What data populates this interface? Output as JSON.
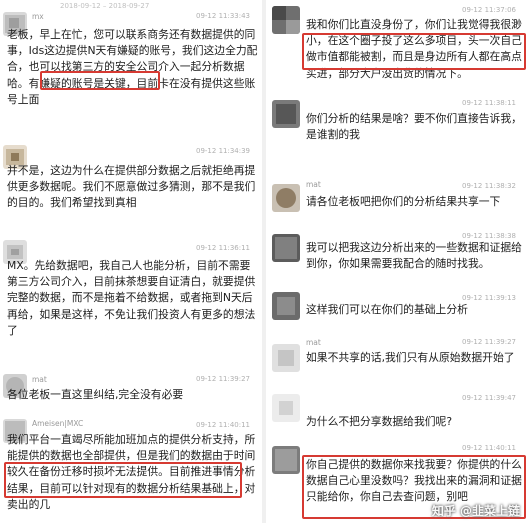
{
  "left": {
    "top_meta": "2018-09-12 – 2018-09-27",
    "messages": [
      {
        "name": "mx",
        "time": "09-12 11:33:43",
        "text": "老板，早上在忙，您可以联系商务还有数据提供的同事，Ids这边提供N天有嫌疑的账号，我们这边全力配合，也可以找第三方的安全公司介入一起分析数据哈。有嫌疑的账号是关键，目前卡在没有提供这些账号上面",
        "highlight": "我们这边全力配合,"
      },
      {
        "name": "",
        "time": "09-12 11:34:39",
        "text": "并不是，这边为什么在提供部分数据之后就拒绝再提供更多数据呢。我们不愿意做过多猜测，那不是我们的目的。我们希望找到真相"
      },
      {
        "name": "",
        "time": "09-12 11:36:11",
        "text": "MX。先给数据吧，我自己人也能分析，目前不需要第三方公司介入，目前抹茶想要自证清白，就要提供完整的数据，而不是拖着不给数据，或者拖到N天后再给，如果是这样，不免让我们投资人有更多的想法了"
      },
      {
        "name": "mat",
        "time": "09-12 11:39:27",
        "text": "各位老板一直这里纠结,完全没有必要"
      },
      {
        "name": "Ameisen|MXC",
        "time": "09-12 11:40:11",
        "text": "我们平台一直竭尽所能加班加点的提供分析支持，所能提供的数据也全部提供，但是我们的数据由于时间较久在备份迁移时损坏无法提供。目前推进事情分析结果，目前可以针对现有的数据分析结果基础上，对卖出的几",
        "highlight": "我们的数据由于时间较久在备份迁移时损坏无法提供。"
      }
    ]
  },
  "right": {
    "messages": [
      {
        "name": "",
        "time": "09-12 11:37:06",
        "text": "我和你们比直没身份了，你们让我觉得我很渺小，在这个圈子投了这么多项目，头一次自己做市值都能被割，而且是身边所有人都在高点买进，部分大户没出货的情况下。",
        "highlight": "很渺小，在这个圈子投了这么多项目，头一次自己做市值都能被割，而且是身边所有人都在高点买进，"
      },
      {
        "name": "",
        "time": "09-12 11:38:11",
        "text": "你们分析的结果是啥？要不你们直接告诉我，是谁割的我"
      },
      {
        "name": "mat",
        "time": "09-12 11:38:32",
        "text": "请各位老板吧把你们的分析结果共享一下"
      },
      {
        "name": "",
        "time": "09-12 11:38:38",
        "text": "我可以把我这边分析出来的一些数据和证据给到你，你如果需要我配合的随时找我。"
      },
      {
        "name": "",
        "time": "09-12 11:39:13",
        "text": "这样我们可以在你们的基础上分析"
      },
      {
        "name": "mat",
        "time": "09-12 11:39:27",
        "text": "如果不共享的话,我们只有从原始数据开始了"
      },
      {
        "name": "",
        "time": "09-12 11:39:47",
        "text": "为什么不把分享数据给我们呢?"
      },
      {
        "name": "",
        "time": "09-12 11:40:11",
        "text": "你自己提供的数据你来找我要？你提供的什么数据自己心里没数吗？我找出来的漏洞和证据只能给你，你自己去查问题，别吧",
        "highlight": "你自己提供的数据你来找我要？你提供的什么数据自己心里没数吗？我找出来的漏洞和证据只能给你"
      }
    ]
  },
  "watermark": "知乎 @韭菜上链"
}
